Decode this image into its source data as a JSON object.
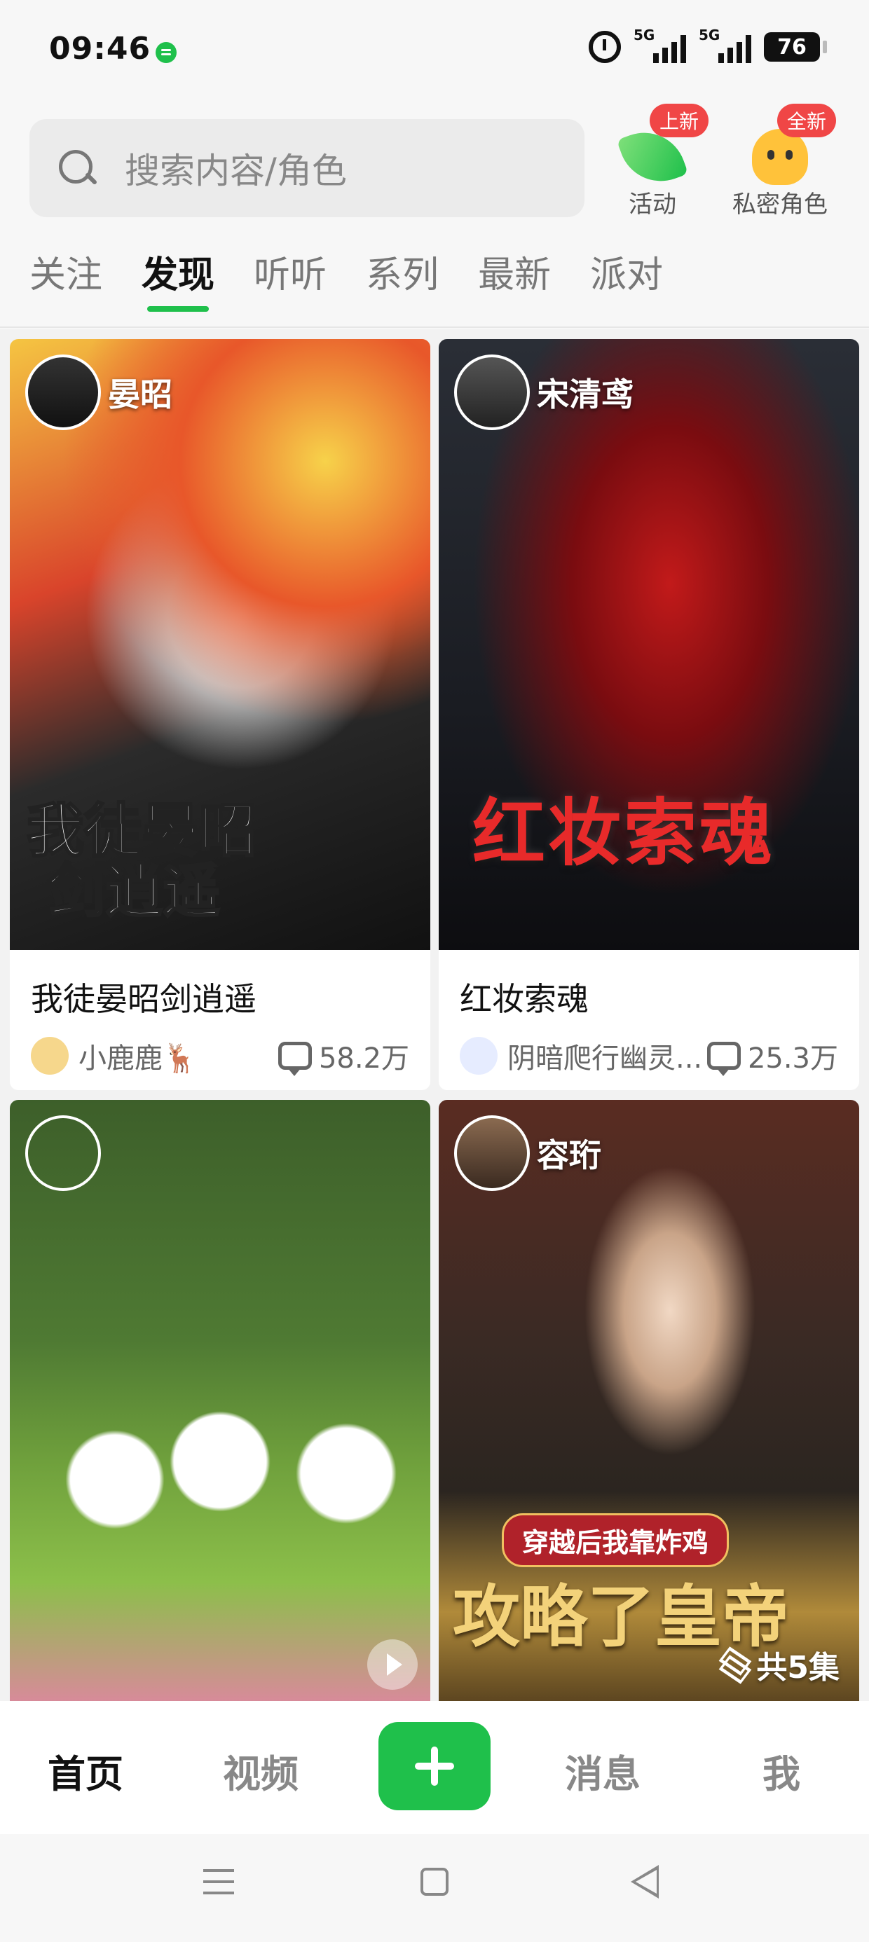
{
  "status_bar": {
    "time": "09:46",
    "network_1": "5G",
    "network_2": "5G",
    "battery": "76"
  },
  "search": {
    "placeholder": "搜索内容/角色"
  },
  "header_buttons": [
    {
      "label": "活动",
      "badge": "上新",
      "icon": "activity-icon"
    },
    {
      "label": "私密角色",
      "badge": "全新",
      "icon": "private-character-icon"
    }
  ],
  "tabs": [
    {
      "label": "关注"
    },
    {
      "label": "发现",
      "active": true
    },
    {
      "label": "听听"
    },
    {
      "label": "系列"
    },
    {
      "label": "最新"
    },
    {
      "label": "派对"
    }
  ],
  "cards": [
    {
      "author": "晏昭",
      "cover_text_1": "我徒晏昭",
      "cover_text_2": "剑逍遥",
      "title": "我徒晏昭剑逍遥",
      "user": "小鹿鹿🦌",
      "comments": "58.2万"
    },
    {
      "author": "宋清鸢",
      "cover_text_1": "红妆索魂",
      "title": "红妆索魂",
      "user": "阴暗爬行幽灵...",
      "comments": "25.3万"
    },
    {
      "author": ""
    },
    {
      "author": "容珩",
      "cover_text_1": "穿越后我靠炸鸡",
      "cover_text_2": "攻略了皇帝",
      "episodes": "共5集"
    }
  ],
  "bottom_nav": {
    "home": "首页",
    "video": "视频",
    "messages": "消息",
    "me": "我"
  },
  "colors": {
    "accent": "#1fc04b",
    "badge": "#f04646"
  }
}
